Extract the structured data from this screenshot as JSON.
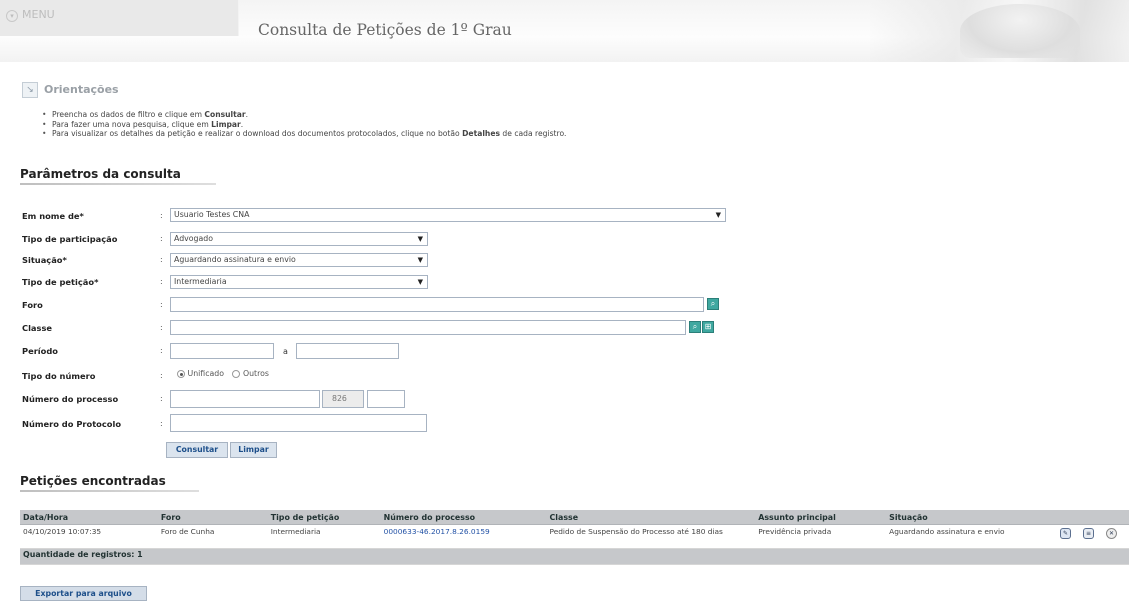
{
  "header": {
    "menu_label": "MENU",
    "menu_icon": "chevron-down-icon",
    "title": "Consulta de Petições de 1º Grau"
  },
  "guidance": {
    "title": "Orientações",
    "items": [
      {
        "pre": "Preencha os dados de filtro e clique em ",
        "strong": "Consultar",
        "post": "."
      },
      {
        "pre": "Para fazer uma nova pesquisa, clique em ",
        "strong": "Limpar",
        "post": "."
      },
      {
        "pre": "Para visualizar os detalhes da petição e realizar o download dos documentos protocolados, clique no botão ",
        "strong": "Detalhes",
        "post": " de cada registro."
      }
    ]
  },
  "params": {
    "section_title": "Parâmetros da consulta",
    "labels": {
      "em_nome_de": "Em nome de*",
      "tipo_participacao": "Tipo de participação",
      "situacao": "Situação*",
      "tipo_peticao": "Tipo de petição*",
      "foro": "Foro",
      "classe": "Classe",
      "periodo": "Período",
      "tipo_numero": "Tipo do número",
      "numero_processo": "Número do processo",
      "numero_protocolo": "Número do Protocolo"
    },
    "values": {
      "em_nome_de": "Usuario Testes CNA",
      "tipo_participacao": "Advogado",
      "situacao": "Aguardando assinatura e envio",
      "tipo_peticao": "Intermediaria",
      "foro": "",
      "classe": "",
      "periodo_inicio": "",
      "periodo_fim": "",
      "numero_processo": "",
      "numero_processo_segmento": "826",
      "numero_processo_foro": "",
      "numero_protocolo": ""
    },
    "periodo_separator": "a",
    "tipo_numero_options": [
      {
        "label": "Unificado",
        "selected": true
      },
      {
        "label": "Outros",
        "selected": false
      }
    ],
    "buttons": {
      "consultar": "Consultar",
      "limpar": "Limpar"
    }
  },
  "results": {
    "section_title": "Petições encontradas",
    "columns": [
      "Data/Hora",
      "Foro",
      "Tipo de petição",
      "Número do processo",
      "Classe",
      "Assunto principal",
      "Situação"
    ],
    "rows": [
      {
        "data_hora": "04/10/2019 10:07:35",
        "foro": "Foro de Cunha",
        "tipo_peticao": "Intermediaria",
        "numero_processo": "0000633-46.2017.8.26.0159",
        "classe": "Pedido de Suspensão do Processo até 180 dias",
        "assunto": "Previdência privada",
        "situacao": "Aguardando assinatura e envio"
      }
    ],
    "row_action_icons": [
      "edit-icon",
      "details-icon",
      "delete-icon"
    ],
    "count_label": "Quantidade de registros: 1",
    "export_button": "Exportar para arquivo"
  }
}
